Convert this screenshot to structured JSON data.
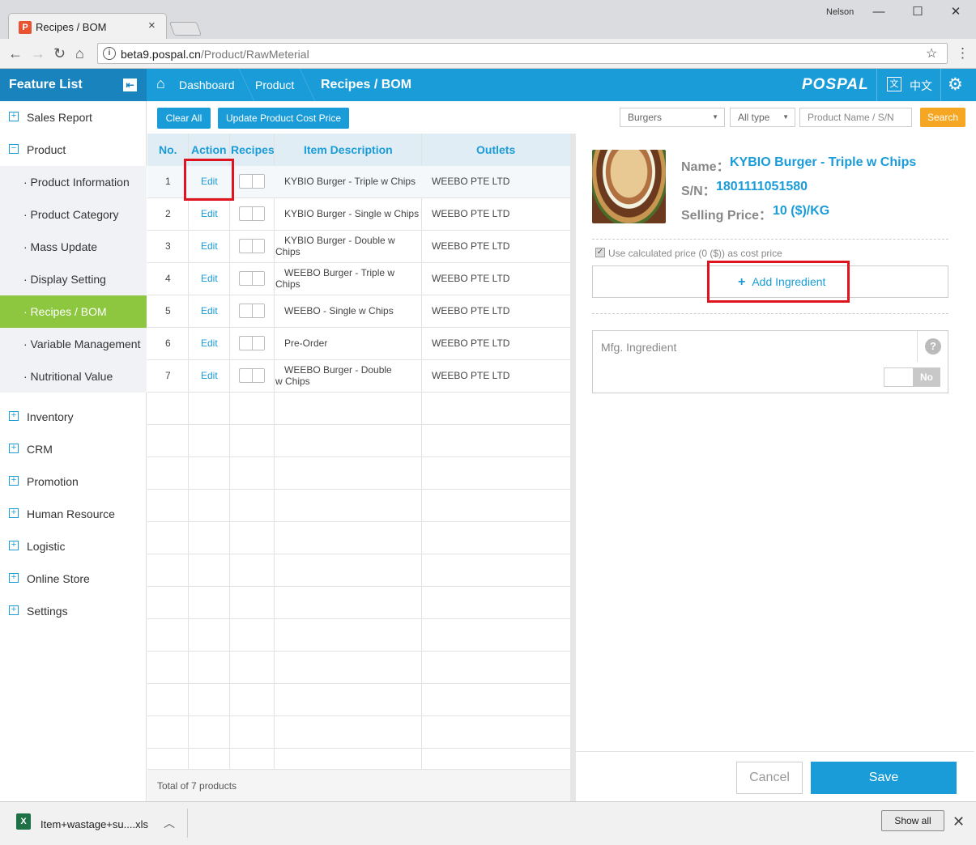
{
  "browser": {
    "tab_title": "Recipes / BOM",
    "user": "Nelson",
    "url_host": "beta9.pospal.cn",
    "url_path": "/Product/RawMeterial"
  },
  "app": {
    "sidebar_title": "Feature List",
    "breadcrumb": [
      "Dashboard",
      "Product",
      "Recipes / BOM"
    ],
    "logo": "POSPAL",
    "language": "中文"
  },
  "sidebar": {
    "sections": [
      {
        "label": "Sales Report",
        "expanded": false
      },
      {
        "label": "Product",
        "expanded": true
      },
      {
        "label": "Inventory",
        "expanded": false
      },
      {
        "label": "CRM",
        "expanded": false
      },
      {
        "label": "Promotion",
        "expanded": false
      },
      {
        "label": "Human Resource",
        "expanded": false
      },
      {
        "label": "Logistic",
        "expanded": false
      },
      {
        "label": "Online Store",
        "expanded": false
      },
      {
        "label": "Settings",
        "expanded": false
      }
    ],
    "product_sub": [
      "· Product Information",
      "· Product Category",
      "· Mass Update",
      "· Display Setting",
      "· Recipes / BOM",
      "· Variable Management",
      "· Nutritional Value"
    ],
    "active_sub": "· Recipes / BOM"
  },
  "toolbar": {
    "clear_all": "Clear All",
    "update_cost": "Update Product Cost Price",
    "category_value": "Burgers",
    "type_value": "All type",
    "search_placeholder": "Product Name / S/N",
    "search_button": "Search"
  },
  "table": {
    "headers": [
      "No.",
      "Action",
      "Recipes",
      "Item Description",
      "Outlets"
    ],
    "rows": [
      {
        "no": "1",
        "action": "Edit",
        "desc": "KYBIO Burger - Triple w Chips",
        "outlet": "WEEBO PTE LTD"
      },
      {
        "no": "2",
        "action": "Edit",
        "desc": "KYBIO Burger - Single w Chips",
        "outlet": "WEEBO PTE LTD"
      },
      {
        "no": "3",
        "action": "Edit",
        "desc": "KYBIO Burger - Double w Chips",
        "outlet": "WEEBO PTE LTD"
      },
      {
        "no": "4",
        "action": "Edit",
        "desc": "WEEBO Burger - Triple w Chips",
        "outlet": "WEEBO PTE LTD"
      },
      {
        "no": "5",
        "action": "Edit",
        "desc": "WEEBO - Single w Chips",
        "outlet": "WEEBO PTE LTD"
      },
      {
        "no": "6",
        "action": "Edit",
        "desc": "Pre-Order",
        "outlet": "WEEBO PTE LTD"
      },
      {
        "no": "7",
        "action": "Edit",
        "desc": "WEEBO Burger - Double w Chips",
        "outlet": "WEEBO PTE LTD"
      }
    ],
    "footer": "Total of 7 products"
  },
  "detail": {
    "name_label": "Name：",
    "name_value": "KYBIO Burger - Triple w Chips",
    "sn_label": "S/N：",
    "sn_value": "1801111051580",
    "price_label": "Selling Price：",
    "price_value": "10 ($)/KG",
    "use_calc_label": "Use calculated price (0 ($)) as cost price",
    "add_ingredient": "Add Ingredient",
    "mfg_label": "Mfg. Ingredient",
    "mfg_toggle": "No",
    "cancel": "Cancel",
    "save": "Save"
  },
  "download": {
    "filename": "Item+wastage+su....xls",
    "show_all": "Show all"
  },
  "colors": {
    "primary": "#1a9cd8",
    "active_nav": "#8dc63f",
    "search": "#f5a623",
    "highlight": "#e0141e"
  }
}
